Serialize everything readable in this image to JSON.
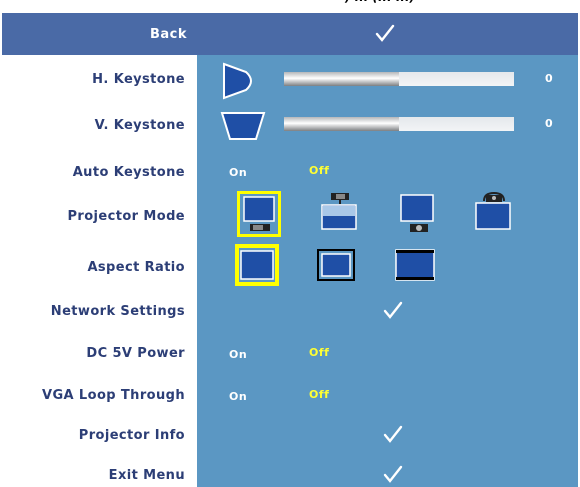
{
  "menu": {
    "back_label": "Back",
    "back_action_icon": "checkmark-icon",
    "rows": {
      "h_keystone": {
        "label": "H. Keystone",
        "value": "0",
        "slider_fraction": 0.5
      },
      "v_keystone": {
        "label": "V. Keystone",
        "value": "0",
        "slider_fraction": 0.5
      },
      "auto_keystone": {
        "label": "Auto Keystone",
        "on": "On",
        "off": "Off",
        "selected": "Off"
      },
      "projector_mode": {
        "label": "Projector Mode",
        "selected_index": 0,
        "options": [
          "front-projection-desktop-icon",
          "rear-projection-ceiling-icon",
          "rear-projection-desktop-icon",
          "front-projection-ceiling-icon"
        ]
      },
      "aspect_ratio": {
        "label": "Aspect Ratio",
        "selected_index": 0,
        "options": [
          "aspect-original-icon",
          "aspect-4-3-icon",
          "aspect-wide-icon"
        ]
      },
      "network_settings": {
        "label": "Network Settings",
        "action_icon": "checkmark-icon"
      },
      "dc_5v_power": {
        "label": "DC 5V Power",
        "on": "On",
        "off": "Off",
        "selected": "Off"
      },
      "vga_loop_through": {
        "label": "VGA Loop Through",
        "on": "On",
        "off": "Off",
        "selected": "Off"
      },
      "projector_info": {
        "label": "Projector Info",
        "action_icon": "checkmark-icon"
      },
      "exit_menu": {
        "label": "Exit Menu",
        "action_icon": "checkmark-icon"
      }
    }
  },
  "colors": {
    "header_bg": "#4a6aa6",
    "panel_bg": "#5b97c3",
    "label_text": "#2c3e76",
    "highlight_yellow": "#ffff33",
    "selected_border": "#ffff00"
  }
}
